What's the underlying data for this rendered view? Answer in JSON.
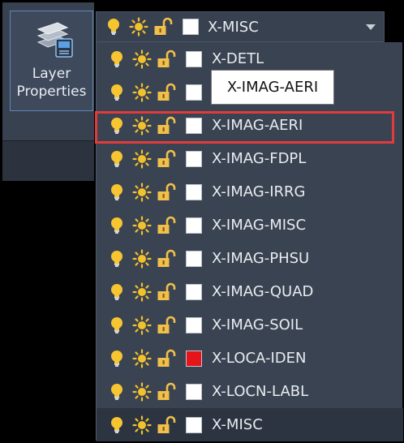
{
  "ribbon": {
    "layer_properties_label_line1": "Layer",
    "layer_properties_label_line2": "Properties"
  },
  "colors": {
    "accent_highlight": "#e13b3b",
    "bulb": "#f7c531",
    "sun": "#f2c12e",
    "lock": "#f1bf4c",
    "white_swatch": "#ffffff",
    "red_swatch": "#e6141a"
  },
  "combo": {
    "current_layer": "X-MISC",
    "swatch_color": "#ffffff",
    "dropdown_icon": "chevron-down-icon"
  },
  "tooltip": {
    "text": "X-IMAG-AERI"
  },
  "dropdown": {
    "items": [
      {
        "name": "X-DETL",
        "swatch": "#ffffff"
      },
      {
        "name": "X-IMAG-AERI",
        "swatch": "#ffffff"
      },
      {
        "name": "X-IMAG-AERI",
        "swatch": "#ffffff",
        "highlighted": true
      },
      {
        "name": "X-IMAG-FDPL",
        "swatch": "#ffffff"
      },
      {
        "name": "X-IMAG-IRRG",
        "swatch": "#ffffff"
      },
      {
        "name": "X-IMAG-MISC",
        "swatch": "#ffffff"
      },
      {
        "name": "X-IMAG-PHSU",
        "swatch": "#ffffff"
      },
      {
        "name": "X-IMAG-QUAD",
        "swatch": "#ffffff"
      },
      {
        "name": "X-IMAG-SOIL",
        "swatch": "#ffffff"
      },
      {
        "name": "X-LOCA-IDEN",
        "swatch": "#e6141a"
      },
      {
        "name": "X-LOCN-LABL",
        "swatch": "#ffffff"
      },
      {
        "name": "X-MISC",
        "swatch": "#ffffff",
        "current": true
      }
    ]
  }
}
